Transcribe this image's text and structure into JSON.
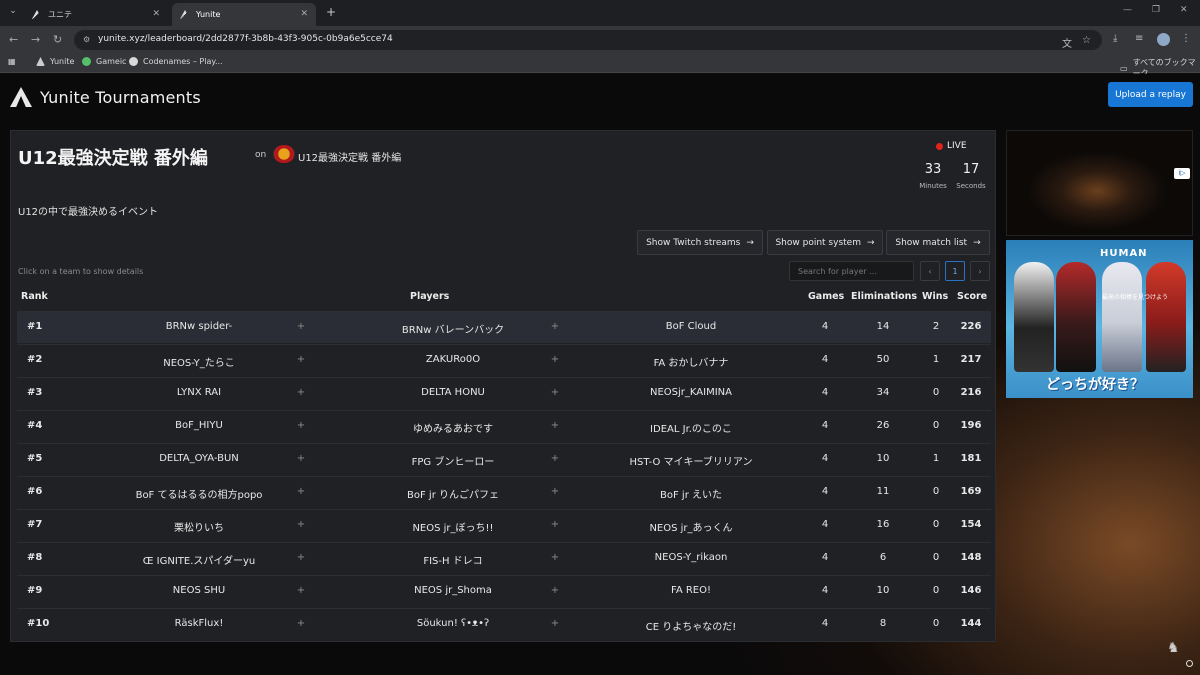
{
  "browser": {
    "tabs": [
      {
        "label": "ユニテ",
        "active": false
      },
      {
        "label": "Yunite",
        "active": true
      }
    ],
    "new_tab": "+",
    "url": "yunite.xyz/leaderboard/2dd2877f-3b8b-43f3-905c-0b9a6e5cce74",
    "bookmarks": [
      {
        "label": "Yunite",
        "color": "#cccccc"
      },
      {
        "label": "Gameic",
        "color": "#54c06a"
      },
      {
        "label": "Codenames – Play...",
        "color": "#d9d9d9"
      }
    ],
    "bookmarks_folder": "すべてのブックマーク"
  },
  "header": {
    "brand": "Yunite Tournaments",
    "upload_button": "Upload a replay"
  },
  "event": {
    "title": "U12最強決定戦 番外編",
    "on_label": "on",
    "org_name": "U12最強決定戦 番外編",
    "description": "U12の中で最強決めるイベント",
    "live_label": "LIVE",
    "timer": {
      "minutes": "33",
      "minutes_label": "Minutes",
      "seconds": "17",
      "seconds_label": "Seconds"
    }
  },
  "actions": {
    "twitch": "Show Twitch streams",
    "points": "Show point system",
    "matches": "Show match list"
  },
  "controls": {
    "hint": "Click on a team to show details",
    "search_placeholder": "Search for player ...",
    "page_prev": "‹",
    "page_current": "1",
    "page_next": "›"
  },
  "table": {
    "headers": {
      "rank": "Rank",
      "players": "Players",
      "games": "Games",
      "eliminations": "Eliminations",
      "wins": "Wins",
      "score": "Score"
    },
    "rows": [
      {
        "rank": "#1",
        "players": [
          "BRNw spider-",
          "BRNw バレーンバック",
          "BoF Cloud"
        ],
        "games": "4",
        "elims": "14",
        "wins": "2",
        "score": "226"
      },
      {
        "rank": "#2",
        "players": [
          "NEOS-Y_たらこ",
          "ZAKURo0O",
          "FA おかしバナナ"
        ],
        "games": "4",
        "elims": "50",
        "wins": "1",
        "score": "217"
      },
      {
        "rank": "#3",
        "players": [
          "LYNX RAI",
          "DELTA HONU",
          "NEOSjr_KAIMINA"
        ],
        "games": "4",
        "elims": "34",
        "wins": "0",
        "score": "216"
      },
      {
        "rank": "#4",
        "players": [
          "BoF_HIYU",
          "ゆめみるあおです",
          "IDEAL Jr.のこのこ"
        ],
        "games": "4",
        "elims": "26",
        "wins": "0",
        "score": "196"
      },
      {
        "rank": "#5",
        "players": [
          "DELTA_OYA-BUN",
          "FPG ブンヒーロー",
          "HST-O マイキーブリリアン"
        ],
        "games": "4",
        "elims": "10",
        "wins": "1",
        "score": "181"
      },
      {
        "rank": "#6",
        "players": [
          "BoF てるはるるの相方popo",
          "BoF jr りんごパフェ",
          "BoF jr えいた"
        ],
        "games": "4",
        "elims": "11",
        "wins": "0",
        "score": "169"
      },
      {
        "rank": "#7",
        "players": [
          "栗松りいち",
          "NEOS jr_ぼっち!!",
          "NEOS jr_あっくん"
        ],
        "games": "4",
        "elims": "16",
        "wins": "0",
        "score": "154"
      },
      {
        "rank": "#8",
        "players": [
          "Œ IGNITE.スパイダーyu",
          "FIS-H ドレコ",
          "NEOS-Y_rikaon"
        ],
        "games": "4",
        "elims": "6",
        "wins": "0",
        "score": "148"
      },
      {
        "rank": "#9",
        "players": [
          "NEOS SHU",
          "NEOS jr_Shoma",
          "FA REO!"
        ],
        "games": "4",
        "elims": "10",
        "wins": "0",
        "score": "146"
      },
      {
        "rank": "#10",
        "players": [
          "RäskFlux!",
          "Söukun! ʕ•ᴥ•ʔ",
          "CE りよちゃなのだ!"
        ],
        "games": "4",
        "elims": "8",
        "wins": "0",
        "score": "144"
      }
    ],
    "separator": "+"
  },
  "ad": {
    "brand": "HUMAN",
    "subtitle": "最高の相棒を見つけよう",
    "headline": "どっちが好き？",
    "badge": "i▷"
  }
}
